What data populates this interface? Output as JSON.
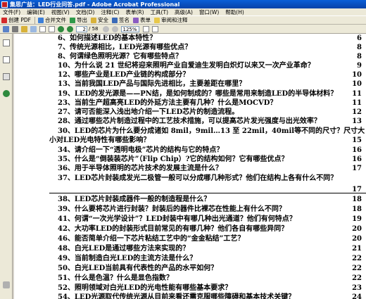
{
  "window": {
    "title": "集思广益：LED行业问答.pdf - Adobe Acrobat Professional"
  },
  "menu": [
    "文件(F)",
    "编辑(E)",
    "视图(V)",
    "文档(D)",
    "注释(C)",
    "表单(R)",
    "工具(T)",
    "高级(A)",
    "窗口(W)",
    "帮助(H)"
  ],
  "toolbar": {
    "create_pdf": "创建 PDF",
    "combine": "合并文件",
    "export": "导出",
    "secure": "安全",
    "sign": "签名",
    "forms": "表单",
    "review": "审阅和注释"
  },
  "nav": {
    "page_current": "2",
    "page_total": "/ 58",
    "zoom": "125%"
  },
  "toc": [
    {
      "text": "6、如何描述LED的基本特性？",
      "page": "6"
    },
    {
      "text": "7、传统光源相比，LED光源有哪些优点？",
      "page": "8"
    },
    {
      "text": "8、何谓绿色照明光源？它有哪些特点？",
      "page": "8"
    },
    {
      "text": "10、为什么说 21 世纪将迎来照明产业自爱迪生发明白炽灯以来又一次产业革命？",
      "page": "9"
    },
    {
      "text": "12、哪些产业是LED产业链的构成部分？",
      "page": "10"
    },
    {
      "text": "13、当前我国LED产品与国际先进相比，主要差距在哪里？",
      "page": "10"
    },
    {
      "text": "19、LED的发光源是——PN结，是如何制成的？哪些是常用来制造LED的半导体材料？",
      "page": "11"
    },
    {
      "text": "23、当前生产超高亮LED的外延方法主要有几种？什么是MOCVD？",
      "page": "11"
    },
    {
      "text": "27、请可否能深入浅出地介绍一下LED芯片的制造流程。",
      "page": "12"
    },
    {
      "text": "28、通过哪些芯片制造过程中的工艺技术措施，可以提高芯片发光强度与出光效率？",
      "page": "13"
    },
    {
      "text": "30、LED的芯片为什么要分成诸如 8mil，9mil…13 至 22mil，40mil等不同的尺寸？尺寸大",
      "page": ""
    },
    {
      "text": "小对LED光电特性有哪些影响？",
      "page": "15"
    },
    {
      "text": "34、请介绍一下“透明电极”芯片的结构与它的特点？",
      "page": "16"
    },
    {
      "text": "35、什么是“倒装装芯片”（Flip Chip）?它的结构如何？它有哪些优点？",
      "page": "16"
    },
    {
      "text": "36、用于半导体照明的芯片技术的发展主流是什么？",
      "page": "17"
    },
    {
      "text": "37、LED芯片封装成发光二极管一般可以分成哪几种形式？他们在结构上各有什么不同？",
      "page": ""
    },
    {
      "text": "",
      "page": "17"
    },
    {
      "text": "38、LED芯片封装成器件一般的制造程是什么？",
      "page": "18"
    },
    {
      "text": "39、什么要将芯片进行封装？封装后的器件比裸芯在性能上有什么不同？",
      "page": "18"
    },
    {
      "text": "41、何谓“一次光学设计”？LED封装中有哪几种出光通道？他们有何特点？",
      "page": "19"
    },
    {
      "text": "42、大功率LED的封装形式目前常见的有哪几种？他们各自有哪些异同？",
      "page": "20"
    },
    {
      "text": "46、能否简单介绍一下芯片粘结工艺中的“金金粘结”工艺？",
      "page": "20"
    },
    {
      "text": "48、白光LED是通过哪些方法来实现的？",
      "page": "21"
    },
    {
      "text": "49、当前制造白光LED的主流方法是什么？",
      "page": "22"
    },
    {
      "text": "50、白光LED当前具有代表性的产品的水平如何？",
      "page": "22"
    },
    {
      "text": "51、什么是色温？什么是显色指数？",
      "page": "22"
    },
    {
      "text": "52、照明领域对白光LED的光电性能有哪些基本要求？",
      "page": "23"
    },
    {
      "text": "54、LED光源取代传统光源从目前来看还需克服哪些障碍和基本技术关键？",
      "page": "24"
    }
  ],
  "colors": {
    "title_bar": "#0842a8",
    "chrome": "#ece9d8",
    "page": "#ffffff"
  }
}
